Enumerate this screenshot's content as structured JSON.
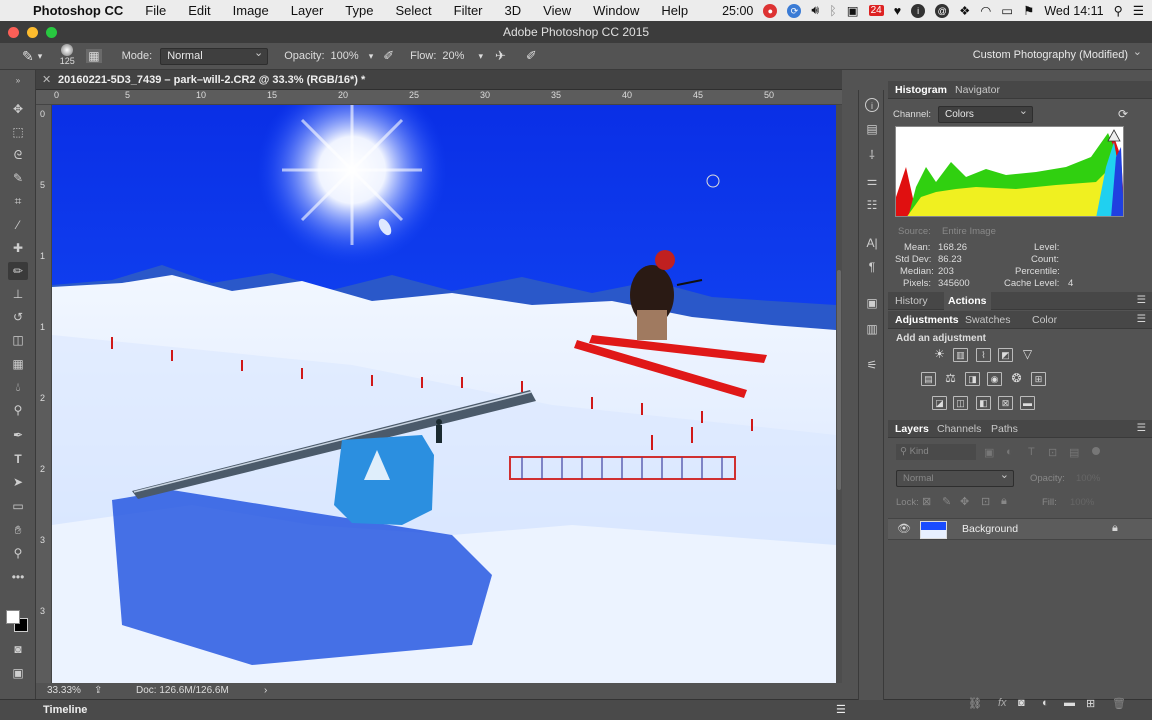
{
  "menubar": {
    "apple": "",
    "app_name": "Photoshop CC",
    "menus": [
      "File",
      "Edit",
      "Image",
      "Layer",
      "Type",
      "Select",
      "Filter",
      "3D",
      "View",
      "Window",
      "Help"
    ],
    "timer": "25:00",
    "calendar": "24",
    "clock": "Wed 14:11"
  },
  "window": {
    "title": "Adobe Photoshop CC 2015"
  },
  "options": {
    "brush_size": "125",
    "mode_label": "Mode:",
    "mode_value": "Normal",
    "opacity_label": "Opacity:",
    "opacity_value": "100%",
    "flow_label": "Flow:",
    "flow_value": "20%",
    "workspace": "Custom Photography (Modified)"
  },
  "document": {
    "tab_title": "20160221-5D3_7439 – park–will-2.CR2 @ 33.3% (RGB/16*) *",
    "hruler_labels": [
      "0",
      "5",
      "10",
      "15",
      "20",
      "25",
      "30",
      "35",
      "40",
      "45",
      "50"
    ],
    "vruler_labels": [
      "0",
      "5",
      "1",
      "1",
      "2",
      "2",
      "3",
      "3"
    ]
  },
  "status": {
    "zoom": "33.33%",
    "doc": "Doc: 126.6M/126.6M"
  },
  "timeline": {
    "label": "Timeline"
  },
  "histogram": {
    "tabs": [
      "Histogram",
      "Navigator"
    ],
    "channel_label": "Channel:",
    "channel_value": "Colors",
    "source_label": "Source:",
    "source_value": "Entire Image",
    "stats": {
      "mean_label": "Mean:",
      "mean": "168.26",
      "stddev_label": "Std Dev:",
      "stddev": "86.23",
      "median_label": "Median:",
      "median": "203",
      "pixels_label": "Pixels:",
      "pixels": "345600",
      "level_label": "Level:",
      "count_label": "Count:",
      "percentile_label": "Percentile:",
      "cache_label": "Cache Level:",
      "cache": "4"
    }
  },
  "history": {
    "tabs": [
      "History",
      "Actions"
    ]
  },
  "adjustments": {
    "tabs": [
      "Adjustments",
      "Swatches",
      "Color"
    ],
    "heading": "Add an adjustment"
  },
  "layers": {
    "tabs": [
      "Layers",
      "Channels",
      "Paths"
    ],
    "kind_placeholder": "Kind",
    "blend_mode": "Normal",
    "opacity_label": "Opacity:",
    "opacity_value": "100%",
    "lock_label": "Lock:",
    "fill_label": "Fill:",
    "fill_value": "100%",
    "layer_name": "Background"
  },
  "colors": {
    "sky": "#0a3df2",
    "snow": "#e9f2ff",
    "accent_red": "#e01818"
  }
}
